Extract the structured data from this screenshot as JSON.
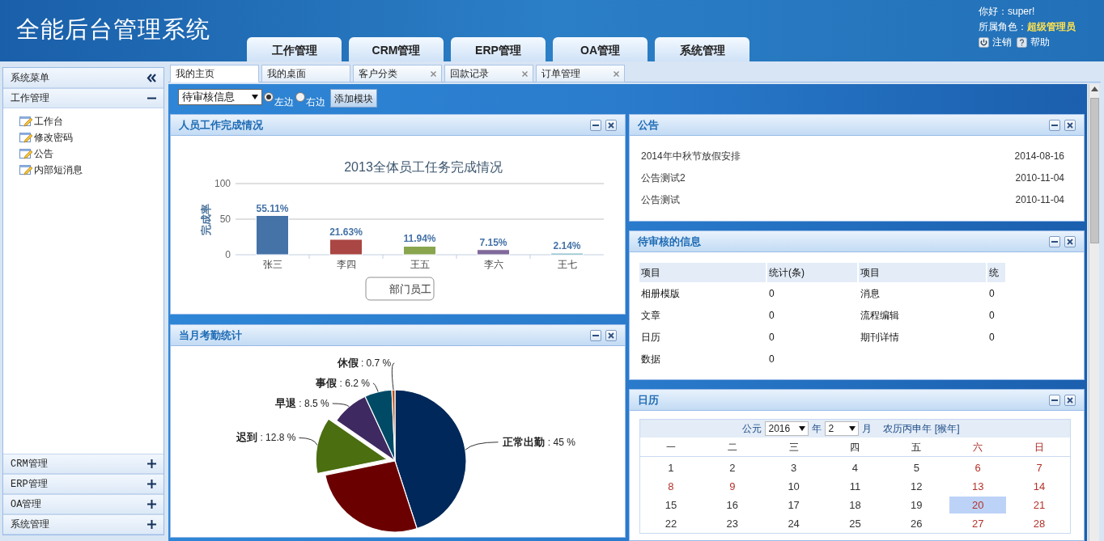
{
  "header": {
    "title": "全能后台管理系统",
    "greeting": "你好：super!",
    "role_label": "所属角色：",
    "role": "超级管理员",
    "logout": "注销",
    "help": "帮助"
  },
  "nav_tabs": [
    {
      "label": "工作管理"
    },
    {
      "label": "CRM管理"
    },
    {
      "label": "ERP管理"
    },
    {
      "label": "OA管理"
    },
    {
      "label": "系统管理"
    }
  ],
  "sidebar": {
    "title": "系统菜单",
    "sections": [
      {
        "label": "工作管理",
        "expanded": true,
        "items": [
          {
            "label": "工作台"
          },
          {
            "label": "修改密码"
          },
          {
            "label": "公告"
          },
          {
            "label": "内部短消息"
          }
        ]
      },
      {
        "label": "CRM管理",
        "expanded": false
      },
      {
        "label": "ERP管理",
        "expanded": false
      },
      {
        "label": "OA管理",
        "expanded": false
      },
      {
        "label": "系统管理",
        "expanded": false
      }
    ]
  },
  "page_tabs": [
    {
      "label": "我的主页",
      "selected": true,
      "closable": false
    },
    {
      "label": "我的桌面",
      "selected": false,
      "closable": false
    },
    {
      "label": "客户分类",
      "selected": false,
      "closable": true
    },
    {
      "label": "回款记录",
      "selected": false,
      "closable": true
    },
    {
      "label": "订单管理",
      "selected": false,
      "closable": true
    }
  ],
  "toolbar": {
    "module_select": "待审核信息",
    "positions": [
      {
        "label": "左边",
        "selected": true
      },
      {
        "label": "右边",
        "selected": false
      }
    ],
    "add_button": "添加模块"
  },
  "left_column": [
    {
      "title": "人员工作完成情况",
      "chart_data": {
        "type": "bar",
        "title": "2013全体员工任务完成情况",
        "ylabel": "完成率",
        "categories": [
          "张三",
          "李四",
          "王五",
          "李六",
          "王七"
        ],
        "series": [
          {
            "name": "部门员工",
            "values": [
              55.11,
              21.63,
              11.94,
              7.15,
              2.14
            ]
          }
        ],
        "colors": [
          "#4572a7",
          "#aa4643",
          "#89a54e",
          "#80699b",
          "#3d96ae"
        ],
        "ylim": [
          0,
          100
        ],
        "yticks": [
          0,
          50,
          100
        ],
        "value_labels": [
          "55.11%",
          "21.63%",
          "11.94%",
          "7.15%",
          "2.14%"
        ]
      }
    },
    {
      "title": "当月考勤统计",
      "exploded_slices": [
        false,
        false,
        true,
        false,
        false,
        false
      ],
      "chart_data": {
        "type": "pie",
        "categories": [
          "正常出勤",
          null,
          "迟到",
          "早退",
          "事假",
          "休假"
        ],
        "values": [
          45,
          26.8,
          12.8,
          8.5,
          6.2,
          0.7
        ],
        "colors": [
          "#00285a",
          "#6b0000",
          "#4a6e10",
          "#3e2a60",
          "#004a66",
          "#c0501a"
        ],
        "value_labels": [
          ": 45 %",
          null,
          ": 12.8 %",
          ": 8.5 %",
          ": 6.2 %",
          ": 0.7 %"
        ]
      }
    }
  ],
  "right_column": [
    {
      "kind": "notices",
      "title": "公告",
      "notices": [
        {
          "title": "2014年中秋节放假安排",
          "date": "2014-08-16"
        },
        {
          "title": "公告测试2",
          "date": "2010-11-04"
        },
        {
          "title": "公告测试",
          "date": "2010-11-04"
        }
      ]
    },
    {
      "kind": "stats",
      "title": "待审核的信息",
      "columns": [
        "项目",
        "统计(条)",
        "项目",
        "统"
      ],
      "rows": [
        [
          "相册模版",
          "0",
          "消息",
          "0"
        ],
        [
          "文章",
          "0",
          "流程编辑",
          "0"
        ],
        [
          "日历",
          "0",
          "期刊详情",
          "0"
        ],
        [
          "数据",
          "0"
        ]
      ]
    },
    {
      "kind": "calendar",
      "title": "日历",
      "era": "公元",
      "year": "2016",
      "year_unit": "年",
      "month": "2",
      "month_unit": "月",
      "lunar": "农历丙申年 [猴年]",
      "weekdays": [
        {
          "label": "一",
          "weekend": false
        },
        {
          "label": "二",
          "weekend": false
        },
        {
          "label": "三",
          "weekend": false
        },
        {
          "label": "四",
          "weekend": false
        },
        {
          "label": "五",
          "weekend": false
        },
        {
          "label": "六",
          "weekend": true
        },
        {
          "label": "日",
          "weekend": true
        }
      ],
      "days": [
        {
          "label": "1",
          "holiday": false,
          "selected": false
        },
        {
          "label": "2",
          "holiday": false,
          "selected": false
        },
        {
          "label": "3",
          "holiday": false,
          "selected": false
        },
        {
          "label": "4",
          "holiday": false,
          "selected": false
        },
        {
          "label": "5",
          "holiday": false,
          "selected": false
        },
        {
          "label": "6",
          "holiday": true,
          "selected": false
        },
        {
          "label": "7",
          "holiday": true,
          "selected": false
        },
        {
          "label": "8",
          "holiday": true,
          "selected": false
        },
        {
          "label": "9",
          "holiday": true,
          "selected": false
        },
        {
          "label": "10",
          "holiday": false,
          "selected": false
        },
        {
          "label": "11",
          "holiday": false,
          "selected": false
        },
        {
          "label": "12",
          "holiday": false,
          "selected": false
        },
        {
          "label": "13",
          "holiday": true,
          "selected": false
        },
        {
          "label": "14",
          "holiday": true,
          "selected": false
        },
        {
          "label": "15",
          "holiday": false,
          "selected": false
        },
        {
          "label": "16",
          "holiday": false,
          "selected": false
        },
        {
          "label": "17",
          "holiday": false,
          "selected": false
        },
        {
          "label": "18",
          "holiday": false,
          "selected": false
        },
        {
          "label": "19",
          "holiday": false,
          "selected": false
        },
        {
          "label": "20",
          "holiday": true,
          "selected": true
        },
        {
          "label": "21",
          "holiday": true,
          "selected": false
        },
        {
          "label": "22",
          "holiday": false,
          "selected": false
        },
        {
          "label": "23",
          "holiday": false,
          "selected": false
        },
        {
          "label": "24",
          "holiday": false,
          "selected": false
        },
        {
          "label": "25",
          "holiday": false,
          "selected": false
        },
        {
          "label": "26",
          "holiday": false,
          "selected": false
        },
        {
          "label": "27",
          "holiday": true,
          "selected": false
        },
        {
          "label": "28",
          "holiday": true,
          "selected": false
        }
      ]
    }
  ]
}
